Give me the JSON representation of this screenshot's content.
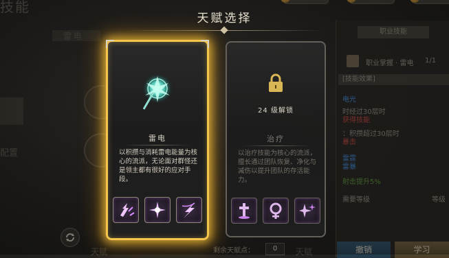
{
  "dialog": {
    "title": "天赋选择"
  },
  "background": {
    "header_text": "技能",
    "top_tab_label": "雷电",
    "bottom_left_label": "配置",
    "bottom_center_label": "天赋",
    "bottom_right_label": "天赋",
    "remaining_points_label": "剩余天赋点：",
    "remaining_points_value": "0"
  },
  "right_panel": {
    "header": "职业技能",
    "class_line": "职业掌握 · 雷电",
    "class_count": "1/1",
    "section_title": "[技能效果]",
    "lines": [
      {
        "text": "电光",
        "color": "#3f82c9"
      },
      {
        "text": "时经过30层时",
        "color": "#8c877b"
      },
      {
        "text": "获得技能",
        "color": "#b8453c"
      },
      {
        "text": "：积攒超过30层时",
        "color": "#8c877b"
      },
      {
        "text": "暴击",
        "color": "#b8453c"
      },
      {
        "text": "雷霆",
        "color": "#3f82c9"
      },
      {
        "text": "雷暴",
        "color": "#3f82c9"
      },
      {
        "text": "射击提升5%",
        "color": "#5a8e3c"
      }
    ],
    "req_label": "需要等级",
    "req_value": "等级",
    "cancel_button": "撤销",
    "learn_button": "学习"
  },
  "cards": [
    {
      "name": "雷电",
      "description": "以积攒与消耗雷电能量为核心的流派，无论面对群怪还是领主都有很好的应对手段。",
      "locked": false,
      "emblem_icon": "lightning-staff-icon",
      "skills": [
        {
          "icon": "chain-lightning-icon"
        },
        {
          "icon": "thunder-burst-icon"
        },
        {
          "icon": "lightning-slash-icon"
        }
      ]
    },
    {
      "name": "治疗",
      "description": "以治疗技能为核心的流派，擅长通过团队恢复、净化与减伤以提升团队的存活能力。",
      "locked": true,
      "lock_text": "24 级解锁",
      "emblem_icon": "lock-icon",
      "skills": [
        {
          "icon": "holy-cross-icon"
        },
        {
          "icon": "healing-totem-icon"
        },
        {
          "icon": "sparkle-heal-icon"
        }
      ]
    }
  ],
  "colors": {
    "selected_glow": "#f3c64b",
    "skill_glow": "#d98bff",
    "emblem_cyan": "#7ee3d0"
  }
}
